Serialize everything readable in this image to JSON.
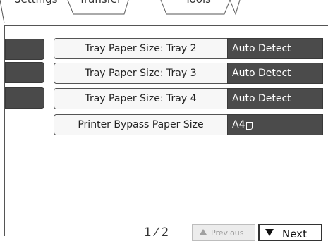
{
  "tabs": [
    {
      "label": "Settings"
    },
    {
      "label": "Transfer"
    },
    {
      "label": "Tools"
    }
  ],
  "settings": [
    {
      "label": "Tray Paper Size: Tray 2",
      "value": "Auto Detect"
    },
    {
      "label": "Tray Paper Size: Tray 3",
      "value": "Auto Detect"
    },
    {
      "label": "Tray Paper Size: Tray 4",
      "value": "Auto Detect"
    },
    {
      "label": "Printer Bypass Paper Size",
      "value": "A4",
      "value_icon": "paper-orientation-icon"
    }
  ],
  "pager": {
    "indicator": "1 ⁄ 2",
    "previous_label": "Previous",
    "next_label": "Next"
  },
  "colors": {
    "value_bg": "#4b4b4b",
    "button_bg": "#f7f7f7"
  }
}
